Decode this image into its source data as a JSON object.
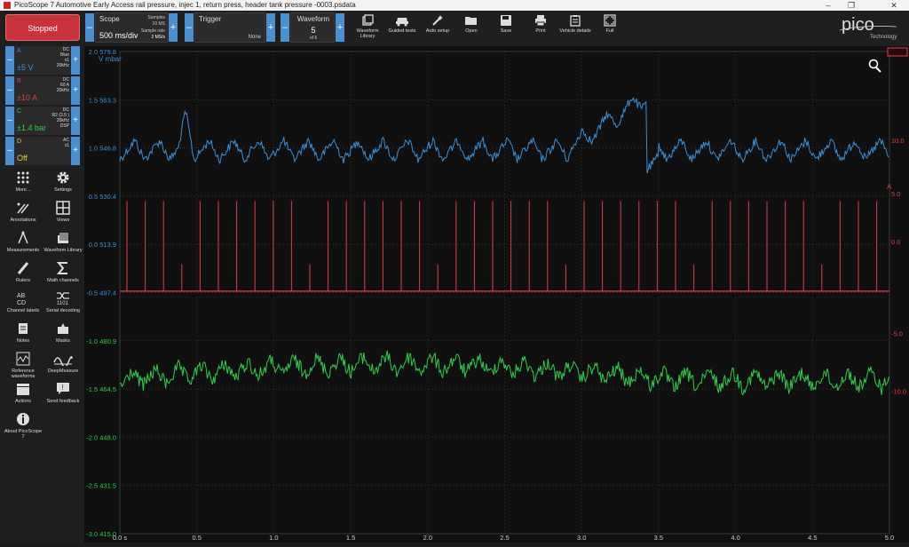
{
  "window": {
    "title": "PicoScope 7 Automotive Early Access rail pressure, injec 1, return press, header tank pressure -0003.psdata"
  },
  "capture": {
    "status": "Stopped"
  },
  "scope": {
    "label": "Scope",
    "timebase": "500 ms/div",
    "samples_label": "Samples",
    "samples_value": "10 MS",
    "rate_label": "Sample rate",
    "rate_value": "2 MS/s"
  },
  "trigger": {
    "label": "Trigger",
    "mode": "None"
  },
  "waveform": {
    "label": "Waveform",
    "current": "5",
    "total": "of 6"
  },
  "toolbar": [
    {
      "name": "waveform-library",
      "label": "Waveform Library"
    },
    {
      "name": "guided-tests",
      "label": "Guided tests"
    },
    {
      "name": "auto-setup",
      "label": "Auto setup"
    },
    {
      "name": "open",
      "label": "Open"
    },
    {
      "name": "save",
      "label": "Save"
    },
    {
      "name": "print",
      "label": "Print"
    },
    {
      "name": "vehicle-details",
      "label": "Vehicle details"
    },
    {
      "name": "full",
      "label": "Full"
    }
  ],
  "logo": {
    "text": "pico",
    "sub": "Technology"
  },
  "channels": [
    {
      "letter": "A",
      "range": "±5 V",
      "m1": "DC",
      "m2": "Blue",
      "m3": "x1",
      "m4": "20kHz",
      "color": "#3b8fd6"
    },
    {
      "letter": "B",
      "range": "±10 A",
      "m1": "DC",
      "m2": "60 A",
      "m3": "20kHz",
      "m4": "",
      "color": "#e23b4a"
    },
    {
      "letter": "C",
      "range": "±1.4 bar",
      "m1": "DC",
      "m2": "R2 (3.5 )",
      "m3": "20kHz",
      "m4": "DSP",
      "color": "#2fcf4a"
    },
    {
      "letter": "D",
      "range": "Off",
      "m1": "AC",
      "m2": "x1",
      "m3": "",
      "m4": "",
      "color": "#e8c82a"
    }
  ],
  "tools": [
    {
      "name": "more",
      "label": "More..."
    },
    {
      "name": "settings",
      "label": "Settings"
    },
    {
      "name": "annotations",
      "label": "Annotations"
    },
    {
      "name": "views",
      "label": "Views"
    },
    {
      "name": "measurements",
      "label": "Measurements"
    },
    {
      "name": "waveform-library",
      "label": "Waveform Library"
    },
    {
      "name": "rulers",
      "label": "Rulers"
    },
    {
      "name": "math-channels",
      "label": "Math channels"
    },
    {
      "name": "channel-labels",
      "label": "Channel labels"
    },
    {
      "name": "serial-decoding",
      "label": "Serial decoding"
    },
    {
      "name": "notes",
      "label": "Notes"
    },
    {
      "name": "masks",
      "label": "Masks"
    },
    {
      "name": "reference-waveforms",
      "label": "Reference waveforms"
    },
    {
      "name": "deepmeasure",
      "label": "DeepMeasure"
    },
    {
      "name": "actions",
      "label": "Actions"
    },
    {
      "name": "send-feedback",
      "label": "Send feedback"
    },
    {
      "name": "about",
      "label": "About PicoScope 7"
    }
  ],
  "plot": {
    "unit_label": "V  mbar",
    "right_unit": "A",
    "y_labels_v": [
      "2.0",
      "1.5",
      "1.0",
      "0.5",
      "0.0",
      "-0.5",
      "-1.0",
      "-1.5",
      "-2.0",
      "-2.5",
      "-3.0"
    ],
    "y_labels_mbar": [
      "579.8",
      "563.3",
      "546.8",
      "530.4",
      "513.9",
      "497.4",
      "480.9",
      "464.5",
      "448.0",
      "431.5",
      "415.0"
    ],
    "y_labels_a": [
      "10.0",
      "5.0",
      "0.0",
      "-5.0",
      "-10.0"
    ],
    "x_labels": [
      "0.0 s",
      "0.5",
      "1.0",
      "1.5",
      "2.0",
      "2.5",
      "3.0",
      "3.5",
      "4.0",
      "4.5",
      "5.0"
    ]
  },
  "colors": {
    "blue": "#3b8fd6",
    "red": "#e23b4a",
    "green": "#2fcf4a",
    "grid": "#2e3a2e"
  }
}
